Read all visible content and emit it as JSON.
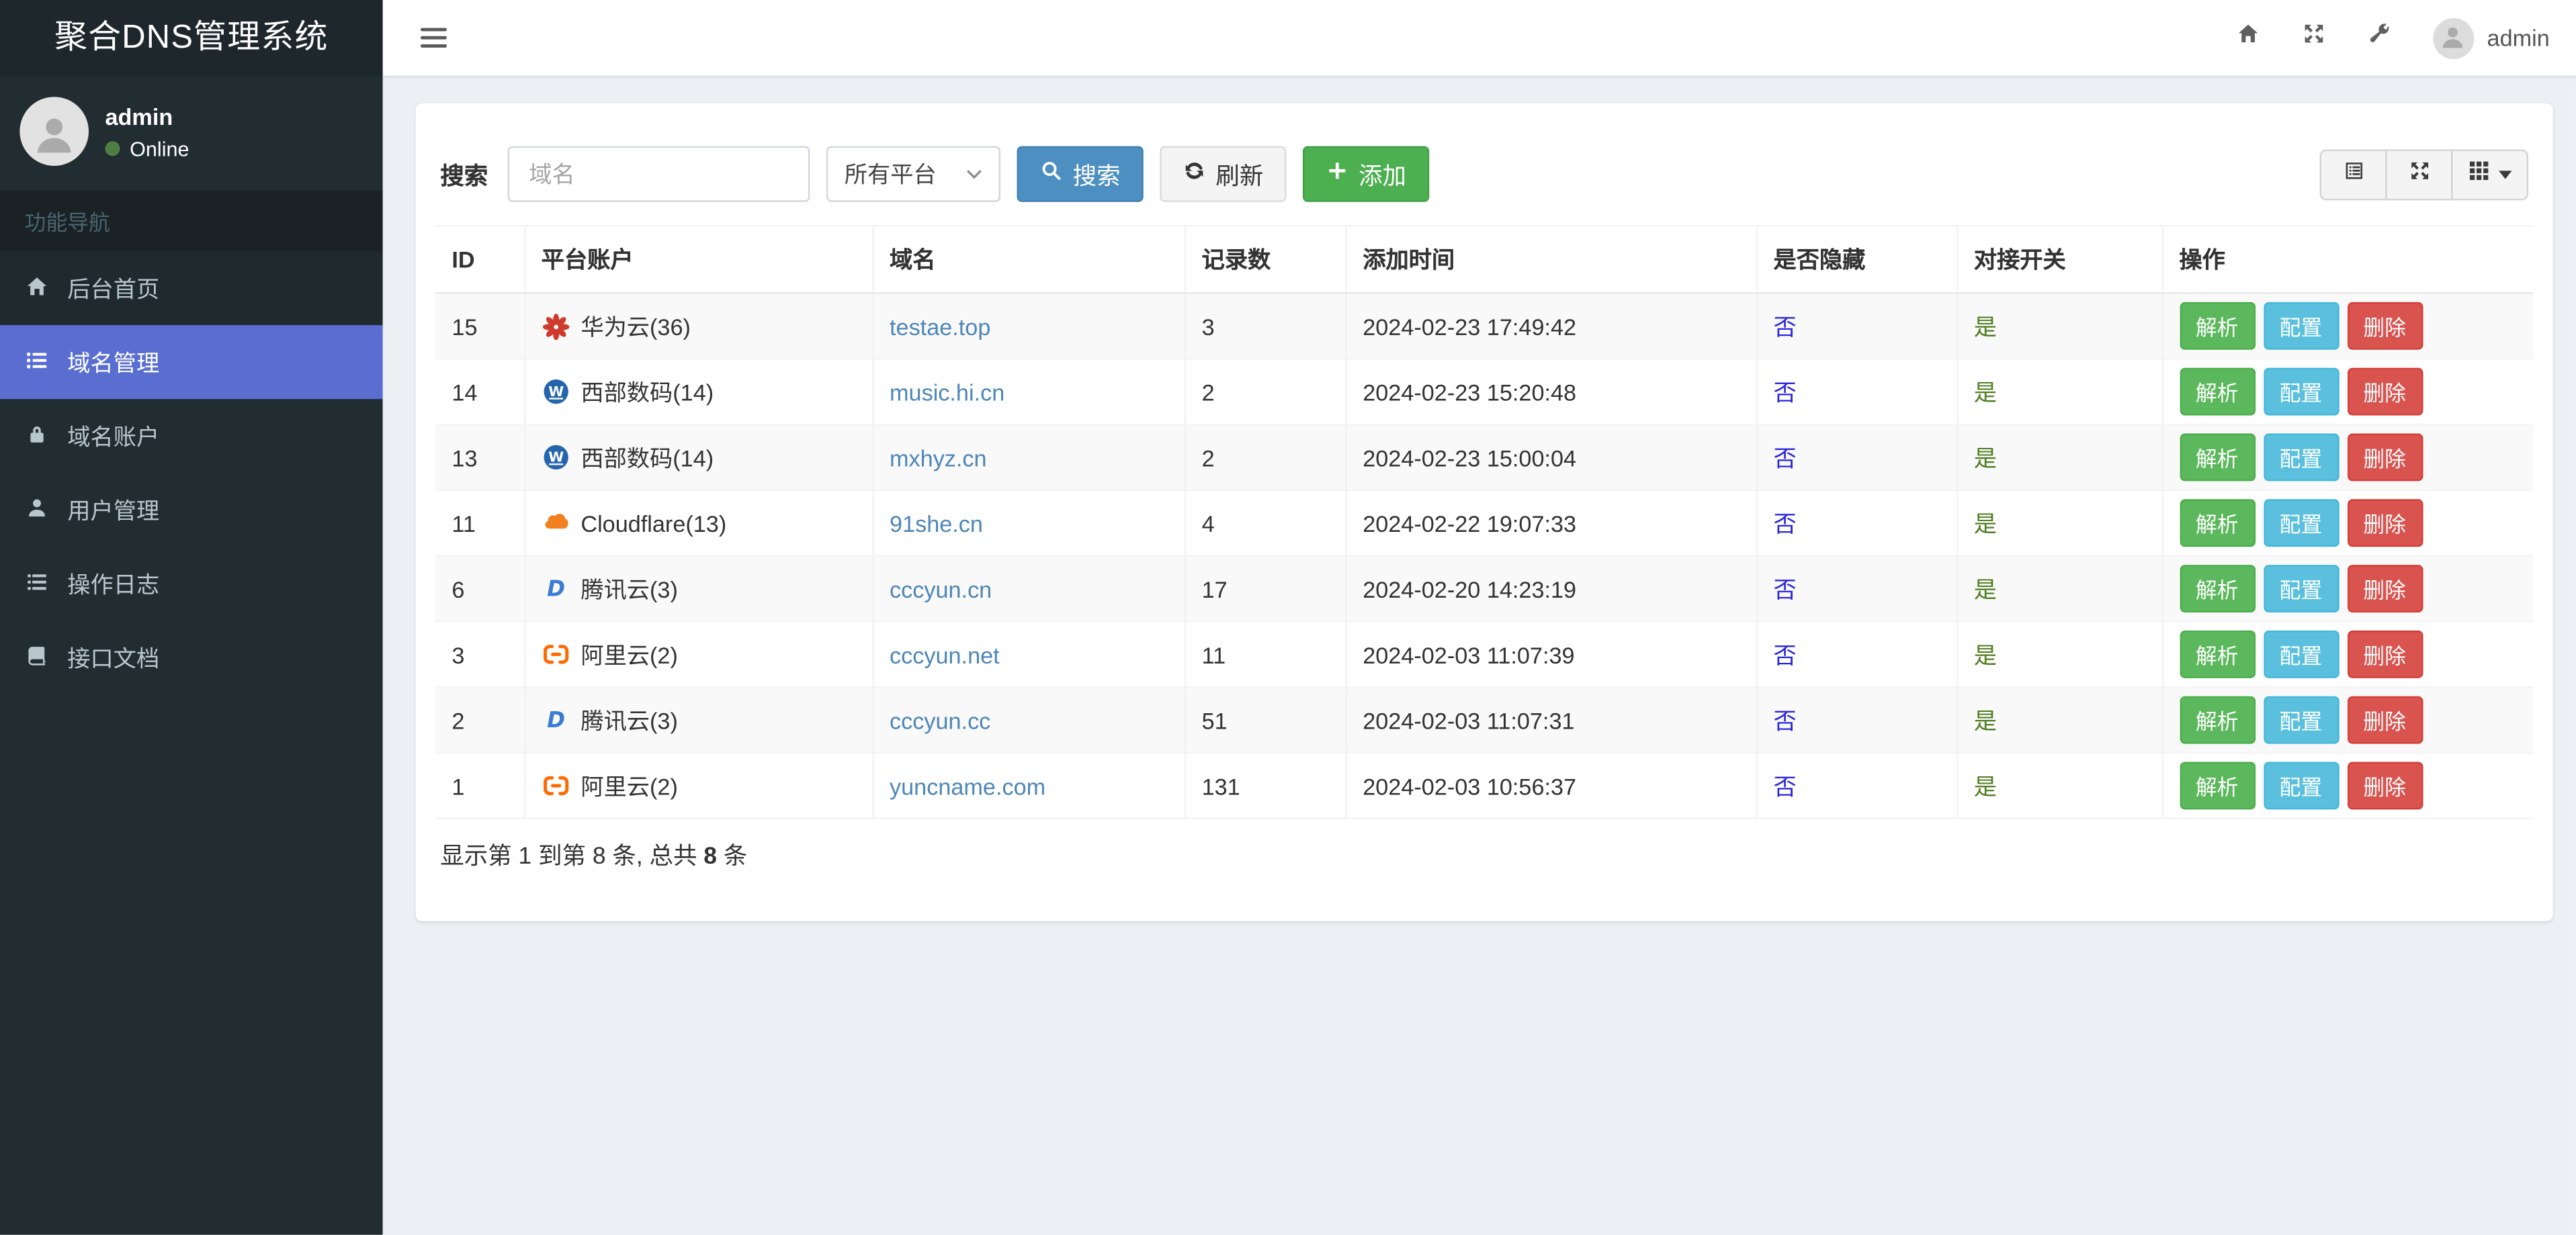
{
  "brand": {
    "title": "聚合DNS管理系统"
  },
  "sidebar": {
    "user": {
      "name": "admin",
      "status": "Online"
    },
    "section_label": "功能导航",
    "items": [
      {
        "label": "后台首页",
        "icon": "home-icon",
        "active": false
      },
      {
        "label": "域名管理",
        "icon": "list-icon",
        "active": true
      },
      {
        "label": "域名账户",
        "icon": "lock-icon",
        "active": false
      },
      {
        "label": "用户管理",
        "icon": "user-icon",
        "active": false
      },
      {
        "label": "操作日志",
        "icon": "log-icon",
        "active": false
      },
      {
        "label": "接口文档",
        "icon": "book-icon",
        "active": false
      }
    ]
  },
  "topbar": {
    "username": "admin"
  },
  "toolbar": {
    "search_label": "搜索",
    "search_placeholder": "域名",
    "platform_select_value": "所有平台",
    "search_button": "搜索",
    "refresh_button": "刷新",
    "add_button": "添加"
  },
  "table": {
    "headers": [
      "ID",
      "平台账户",
      "域名",
      "记录数",
      "添加时间",
      "是否隐藏",
      "对接开关",
      "操作"
    ],
    "action_labels": [
      "解析",
      "配置",
      "删除"
    ],
    "rows": [
      {
        "id": "15",
        "platform": "华为云(36)",
        "icon": "huawei-icon",
        "domain": "testae.top",
        "records": "3",
        "added": "2024-02-23 17:49:42",
        "hidden": "否",
        "switch": "是"
      },
      {
        "id": "14",
        "platform": "西部数码(14)",
        "icon": "west-icon",
        "domain": "music.hi.cn",
        "records": "2",
        "added": "2024-02-23 15:20:48",
        "hidden": "否",
        "switch": "是"
      },
      {
        "id": "13",
        "platform": "西部数码(14)",
        "icon": "west-icon",
        "domain": "mxhyz.cn",
        "records": "2",
        "added": "2024-02-23 15:00:04",
        "hidden": "否",
        "switch": "是"
      },
      {
        "id": "11",
        "platform": "Cloudflare(13)",
        "icon": "cloudflare-icon",
        "domain": "91she.cn",
        "records": "4",
        "added": "2024-02-22 19:07:33",
        "hidden": "否",
        "switch": "是"
      },
      {
        "id": "6",
        "platform": "腾讯云(3)",
        "icon": "tencent-icon",
        "domain": "cccyun.cn",
        "records": "17",
        "added": "2024-02-20 14:23:19",
        "hidden": "否",
        "switch": "是"
      },
      {
        "id": "3",
        "platform": "阿里云(2)",
        "icon": "aliyun-icon",
        "domain": "cccyun.net",
        "records": "11",
        "added": "2024-02-03 11:07:39",
        "hidden": "否",
        "switch": "是"
      },
      {
        "id": "2",
        "platform": "腾讯云(3)",
        "icon": "tencent-icon",
        "domain": "cccyun.cc",
        "records": "51",
        "added": "2024-02-03 11:07:31",
        "hidden": "否",
        "switch": "是"
      },
      {
        "id": "1",
        "platform": "阿里云(2)",
        "icon": "aliyun-icon",
        "domain": "yuncname.com",
        "records": "131",
        "added": "2024-02-03 10:56:37",
        "hidden": "否",
        "switch": "是"
      }
    ]
  },
  "summary": {
    "prefix": "显示第 1 到第 8 条, 总共 ",
    "total": "8",
    "suffix": " 条"
  },
  "colors": {
    "sidebar_bg": "#222d32",
    "active_nav": "#5a6ed2",
    "online_dot": "#4f7e43",
    "search_button": "#4d8fc0",
    "add_button": "#4caf50",
    "parse_button": "#5cb85c",
    "config_button": "#5bc0de",
    "delete_button": "#d9534f",
    "domain_link": "#4d86b8",
    "hidden_link": "#2a25dd",
    "switch_link": "#4e7d1e"
  }
}
